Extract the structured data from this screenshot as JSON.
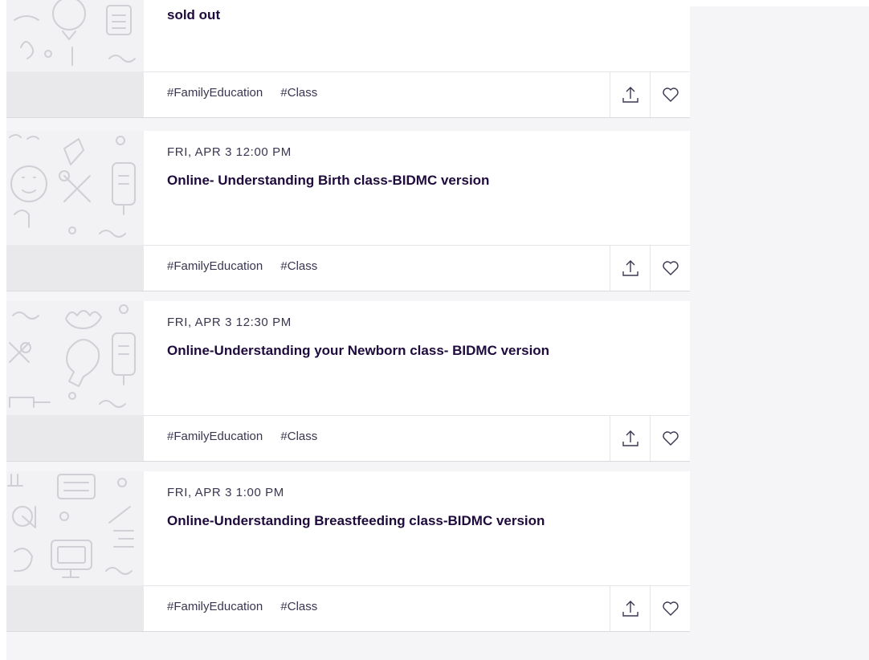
{
  "events": [
    {
      "date": "",
      "title": "sold out",
      "tags": [
        "#FamilyEducation",
        "#Class"
      ]
    },
    {
      "date": "FRI, APR 3 12:00 PM",
      "title": "Online- Understanding Birth class-BIDMC version",
      "tags": [
        "#FamilyEducation",
        "#Class"
      ]
    },
    {
      "date": "FRI, APR 3 12:30 PM",
      "title": "Online-Understanding your Newborn class- BIDMC version",
      "tags": [
        "#FamilyEducation",
        "#Class"
      ]
    },
    {
      "date": "FRI, APR 3 1:00 PM",
      "title": "Online-Understanding Breastfeeding class-BIDMC version",
      "tags": [
        "#FamilyEducation",
        "#Class"
      ]
    }
  ],
  "icons": {
    "share": "share-icon",
    "like": "heart-icon"
  },
  "colors": {
    "title": "#1e0a3c",
    "text": "#39364f",
    "page_bg": "#f5f5f8",
    "thumb_bg": "#f2f2f4",
    "thumb_foot": "#e9e9ec"
  }
}
